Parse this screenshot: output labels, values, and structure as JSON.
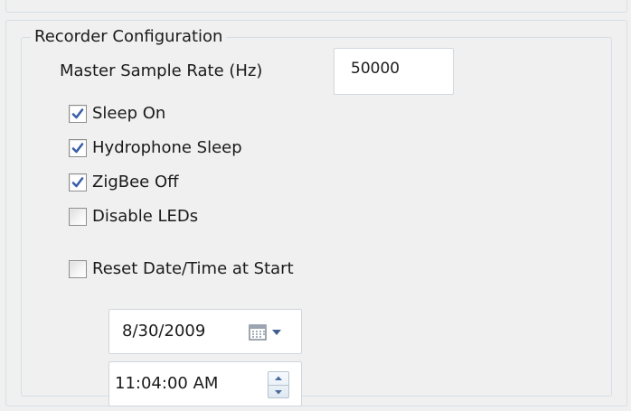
{
  "group": {
    "title": "Recorder Configuration"
  },
  "sample_rate": {
    "label": "Master Sample Rate (Hz)",
    "value": "50000"
  },
  "options": [
    {
      "label": "Sleep On",
      "checked": true
    },
    {
      "label": "Hydrophone Sleep",
      "checked": true
    },
    {
      "label": "ZigBee Off",
      "checked": true
    },
    {
      "label": "Disable LEDs",
      "checked": false
    }
  ],
  "reset": {
    "label": "Reset Date/Time at Start",
    "checked": false
  },
  "date_picker": {
    "value": "8/30/2009",
    "icon": "calendar-dropdown-icon"
  },
  "time_picker": {
    "value": "11:04:00 AM",
    "icon": "spinner-icon"
  },
  "colors": {
    "check": "#3a5fa8",
    "border": "#d5dfe5",
    "background": "#f0f0f0"
  }
}
